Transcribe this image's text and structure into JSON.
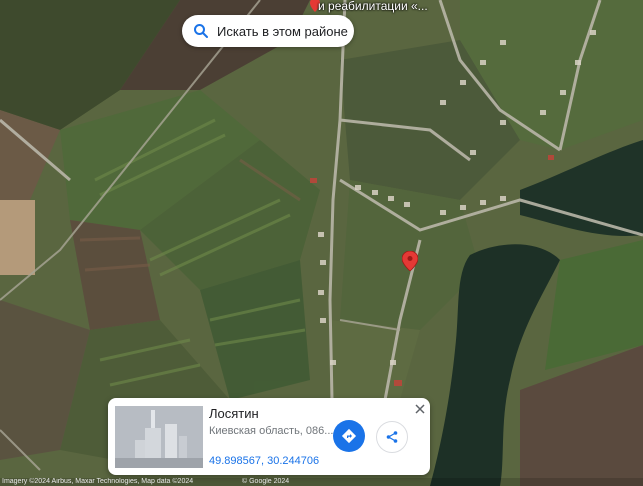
{
  "map": {
    "type": "satellite",
    "poi_label": "и реабилитации «..."
  },
  "search": {
    "label": "Искать в этом районе"
  },
  "place_card": {
    "title": "Лосятин",
    "subtitle": "Киевская область, 086...",
    "coordinates": "49.898567, 30.244706",
    "directions_icon": "directions-icon",
    "share_icon": "share-icon",
    "close_icon": "close-icon"
  },
  "attribution": {
    "left": "Imagery ©2024 Airbus, Maxar Technologies, Map data ©2024",
    "right": "© Google 2024"
  },
  "colors": {
    "accent": "#1a73e8",
    "pin": "#e53935",
    "water": "#1f3328"
  }
}
